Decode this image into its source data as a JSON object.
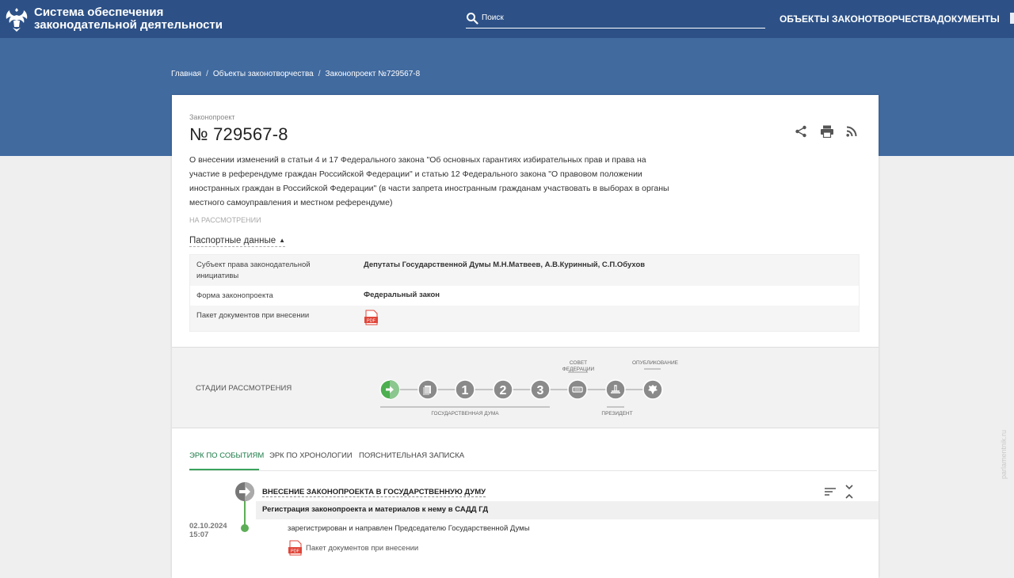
{
  "header": {
    "brand_line1": "Система обеспечения",
    "brand_line2": "законодательной деятельности",
    "search_placeholder": "Поиск",
    "nav": [
      "ОБЪЕКТЫ ЗАКОНОТВОРЧЕСТВА",
      "ДОКУМЕНТЫ"
    ],
    "logo_icon": "double-headed-eagle-icon",
    "colors": {
      "topbar": "#2d5187",
      "hero": "#416a9f",
      "accent": "#3aa35c"
    }
  },
  "breadcrumbs": [
    "Главная",
    "Объекты законотворчества",
    "Законопроект №729567-8"
  ],
  "bill": {
    "type_label": "Законопроект",
    "number": "№ 729567-8",
    "description_lines": [
      "О внесении изменений в статьи 4 и 17 Федерального закона \"Об основных гарантиях избирательных прав и права на",
      "участие в референдуме граждан Российской Федерации\" и статью 12 Федерального закона \"О правовом положении",
      "иностранных граждан в Российской Федерации\" (в части запрета иностранным гражданам участвовать в выборах в органы",
      "местного самоуправления и местном референдуме)"
    ],
    "status": "НА РАССМОТРЕНИИ",
    "actions": [
      "share-icon",
      "print-icon",
      "rss-icon"
    ]
  },
  "passport": {
    "toggle_label": "Паспортные данные",
    "rows": [
      {
        "label_lines": [
          "Субъект права законодательной",
          "инициативы"
        ],
        "value": "Депутаты Государственной Думы М.Н.Матвеев, А.В.Куринный, С.П.Обухов"
      },
      {
        "label_lines": [
          "Форма законопроекта"
        ],
        "value": "Федеральный закон"
      },
      {
        "label_lines": [
          "Пакет документов при внесении"
        ],
        "value": "",
        "icon": "pdf-icon"
      }
    ]
  },
  "stages": {
    "title": "СТАДИИ РАССМОТРЕНИЯ",
    "steps": [
      {
        "icon": "arrow-right-icon",
        "label": "",
        "active": true
      },
      {
        "icon": "document-icon",
        "label": "",
        "active": false
      },
      {
        "icon": "",
        "label": "1",
        "active": false
      },
      {
        "icon": "",
        "label": "2",
        "active": false
      },
      {
        "icon": "",
        "label": "3",
        "active": false
      },
      {
        "icon": "keyboard-icon",
        "label": "",
        "active": false
      },
      {
        "icon": "stamp-icon",
        "label": "",
        "active": false
      },
      {
        "icon": "emblem-icon",
        "label": "",
        "active": false
      }
    ],
    "group_labels": {
      "duma": "ГОСУДАРСТВЕННАЯ ДУМА",
      "council_line1": "СОВЕТ",
      "council_line2": "ФЕДЕРАЦИИ",
      "president": "ПРЕЗИДЕНТ",
      "publication": "ОПУБЛИКОВАНИЕ"
    }
  },
  "tabs": [
    {
      "label": "ЭРК ПО СОБЫТИЯМ",
      "active": true
    },
    {
      "label": "ЭРК ПО ХРОНОЛОГИИ",
      "active": false
    },
    {
      "label": "ПОЯСНИТЕЛЬНАЯ ЗАПИСКА",
      "active": false
    }
  ],
  "events": {
    "stage_title": "ВНЕСЕНИЕ ЗАКОНОПРОЕКТА В ГОСУДАРСТВЕННУЮ ДУМУ",
    "substage_title": "Регистрация законопроекта и материалов к нему в САДД ГД",
    "entries": [
      {
        "date": "02.10.2024",
        "time": "15:07",
        "text": "зарегистрирован и направлен Председателю Государственной Думы",
        "doc_label": "Пакет документов при внесении",
        "doc_icon": "pdf-icon"
      }
    ],
    "controls": [
      "sort-icon",
      "collapse-icon"
    ]
  },
  "watermark": "parlamentnik.ru"
}
